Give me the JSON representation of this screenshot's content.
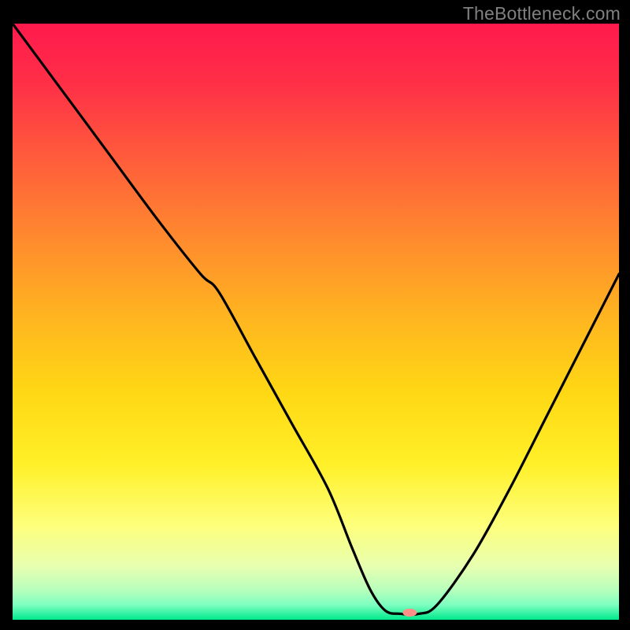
{
  "watermark": "TheBottleneck.com",
  "chart_data": {
    "type": "line",
    "title": "",
    "xlabel": "",
    "ylabel": "",
    "xlim": [
      0,
      100
    ],
    "ylim": [
      0,
      100
    ],
    "background_gradient": {
      "stops": [
        {
          "offset": 0.0,
          "color": "#ff1a4d"
        },
        {
          "offset": 0.1,
          "color": "#ff2f47"
        },
        {
          "offset": 0.22,
          "color": "#ff5a3c"
        },
        {
          "offset": 0.36,
          "color": "#ff8a2e"
        },
        {
          "offset": 0.5,
          "color": "#ffb71f"
        },
        {
          "offset": 0.62,
          "color": "#ffd814"
        },
        {
          "offset": 0.74,
          "color": "#fff029"
        },
        {
          "offset": 0.84,
          "color": "#feff7a"
        },
        {
          "offset": 0.91,
          "color": "#e8ffb0"
        },
        {
          "offset": 0.95,
          "color": "#b8ffbc"
        },
        {
          "offset": 0.975,
          "color": "#7dffc0"
        },
        {
          "offset": 1.0,
          "color": "#00e98c"
        }
      ]
    },
    "series": [
      {
        "name": "bottleneck-curve",
        "x": [
          0,
          8,
          16,
          24,
          31,
          34,
          40,
          46,
          52,
          56,
          59,
          61.5,
          64,
          67,
          70,
          76,
          82,
          88,
          94,
          100
        ],
        "y": [
          100,
          89,
          78,
          67,
          58,
          55,
          44,
          33,
          22,
          12,
          5,
          1.5,
          1.0,
          1.0,
          2.5,
          11,
          22,
          34,
          46,
          58
        ]
      }
    ],
    "marker": {
      "name": "optimal-point",
      "x": 65.5,
      "y": 1.2,
      "color": "#ff8f87",
      "rx": 9,
      "ry": 5
    },
    "grid": false,
    "legend": false
  }
}
